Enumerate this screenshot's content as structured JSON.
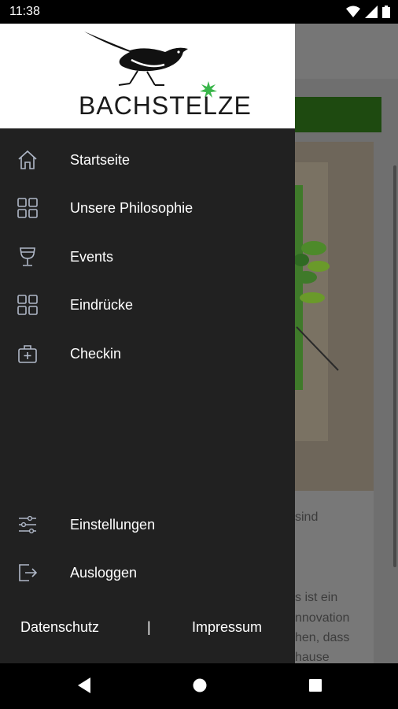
{
  "status_bar": {
    "time": "11:38"
  },
  "drawer": {
    "logo_text": "BACHSTELZE",
    "menu": [
      {
        "label": "Startseite",
        "icon": "home-icon"
      },
      {
        "label": "Unsere Philosophie",
        "icon": "grid-icon"
      },
      {
        "label": "Events",
        "icon": "wine-glass-icon"
      },
      {
        "label": "Eindrücke",
        "icon": "grid-icon"
      },
      {
        "label": "Checkin",
        "icon": "medical-bag-icon"
      }
    ],
    "bottom_menu": [
      {
        "label": "Einstellungen",
        "icon": "sliders-icon"
      },
      {
        "label": "Ausloggen",
        "icon": "logout-icon"
      }
    ],
    "footer": {
      "privacy": "Datenschutz",
      "separator": "|",
      "imprint": "Impressum"
    }
  },
  "background_page": {
    "text_line_1": "sind",
    "text_line_2": "s ist ein",
    "text_line_3": "nnovation",
    "text_line_4": "hen, dass",
    "text_line_5": "hause"
  },
  "colors": {
    "drawer_bg": "#212121",
    "brand_green": "#1e4a10",
    "leaf_green": "#39b54a",
    "icon_color": "#b0b8c8"
  }
}
